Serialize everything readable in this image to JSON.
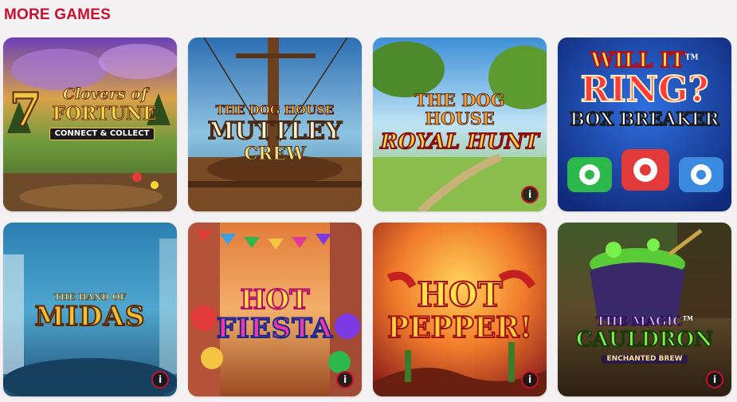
{
  "header": {
    "title": "MORE GAMES"
  },
  "colors": {
    "title": "#c8102e",
    "info_ring": "#c8102e"
  },
  "games": [
    {
      "line1": "7",
      "line2": "Clovers of",
      "line3": "FORTUNE",
      "line4": "CONNECT & COLLECT",
      "has_info": false
    },
    {
      "line1": "THE DOG HOUSE",
      "line2": "MUTTLEY",
      "line3": "CREW",
      "has_info": false
    },
    {
      "line1": "THE DOG",
      "line2": "HOUSE",
      "line3": "ROYAL HUNT",
      "has_info": true
    },
    {
      "line1": "WILL IT",
      "line1_mark": "TM",
      "line2": "RING?",
      "line3": "BOX BREAKER",
      "has_info": false
    },
    {
      "line1": "THE HAND OF",
      "line2": "MIDAS",
      "has_info": true
    },
    {
      "line1": "HOT",
      "line2": "FIESTA",
      "has_info": true
    },
    {
      "line1": "HOT",
      "line2": "PEPPER!",
      "has_info": true
    },
    {
      "line1": "THE MAGIC",
      "line1_mark": "TM",
      "line2": "CAULDRON",
      "line3": "ENCHANTED BREW",
      "has_info": true
    }
  ],
  "info_icon": {
    "name": "info-icon",
    "glyph": "i"
  }
}
